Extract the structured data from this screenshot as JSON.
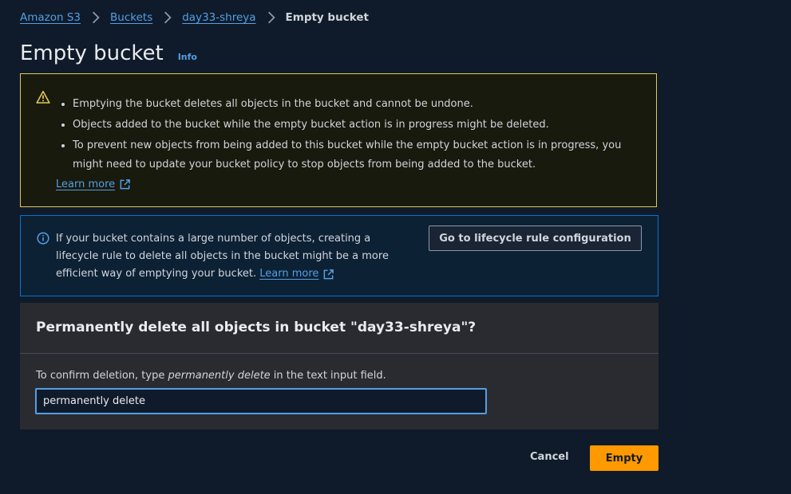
{
  "breadcrumb": {
    "items": [
      "Amazon S3",
      "Buckets",
      "day33-shreya"
    ],
    "current": "Empty bucket"
  },
  "header": {
    "title": "Empty bucket",
    "info_link": "Info"
  },
  "warning": {
    "items": [
      "Emptying the bucket deletes all objects in the bucket and cannot be undone.",
      "Objects added to the bucket while the empty bucket action is in progress might be deleted.",
      "To prevent new objects from being added to this bucket while the empty bucket action is in progress, you might need to update your bucket policy to stop objects from being added to the bucket."
    ],
    "learn_more": "Learn more",
    "icon": "warning-triangle-icon"
  },
  "info_alert": {
    "text": "If your bucket contains a large number of objects, creating a lifecycle rule to delete all objects in the bucket might be a more efficient way of emptying your bucket.",
    "learn_more": "Learn more",
    "button": "Go to lifecycle rule configuration",
    "icon": "info-circle-icon"
  },
  "confirm": {
    "title": "Permanently delete all objects in bucket \"day33-shreya\"?",
    "label_before": "To confirm deletion, type ",
    "label_emphasis": "permanently delete",
    "label_after": " in the text input field.",
    "input_value": "permanently delete"
  },
  "actions": {
    "cancel": "Cancel",
    "empty": "Empty"
  },
  "colors": {
    "background": "#0f1b2a",
    "link": "#539fe5",
    "warning_border": "#e0ca57",
    "info_border": "#0972d3",
    "primary_button": "#ff9900"
  }
}
